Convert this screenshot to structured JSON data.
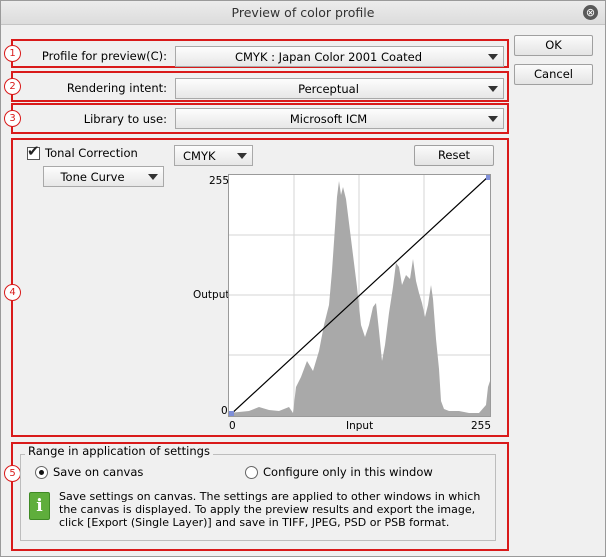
{
  "window": {
    "title": "Preview of color profile",
    "close_glyph": "⊗"
  },
  "buttons": {
    "ok": "OK",
    "cancel": "Cancel",
    "reset": "Reset"
  },
  "rows": [
    {
      "num": "1",
      "label": "Profile for preview(C):",
      "value": "CMYK : Japan Color 2001 Coated"
    },
    {
      "num": "2",
      "label": "Rendering intent:",
      "value": "Perceptual"
    },
    {
      "num": "3",
      "label": "Library to use:",
      "value": "Microsoft ICM"
    }
  ],
  "tonal": {
    "num": "4",
    "checkbox_label": "Tonal Correction",
    "checked": true,
    "mode": "Tone Curve",
    "channel": "CMYK",
    "curve": {
      "y_top": "255",
      "y_bottom": "0",
      "y_label": "Output",
      "x_left": "0",
      "x_label": "Input",
      "x_right": "255",
      "points": [
        [
          0,
          0
        ],
        [
          255,
          255
        ]
      ]
    }
  },
  "range": {
    "num": "5",
    "legend": "Range in application of settings",
    "options": [
      {
        "label": "Save on canvas",
        "selected": true
      },
      {
        "label": "Configure only in this window",
        "selected": false
      }
    ],
    "info_icon": "i",
    "info_lines": [
      "Save settings on canvas. The settings are applied to other windows in which",
      "the canvas is displayed. To apply the preview results and export the image,",
      "click [Export (Single Layer)] and save in TIFF, JPEG, PSD or PSB format."
    ]
  },
  "colors": {
    "annotation": "#d91a1a",
    "histogram": "#a9a9a9",
    "curve": "#000000",
    "curve_handle": "#7f8fd8",
    "info_icon": "#5fae3c"
  }
}
